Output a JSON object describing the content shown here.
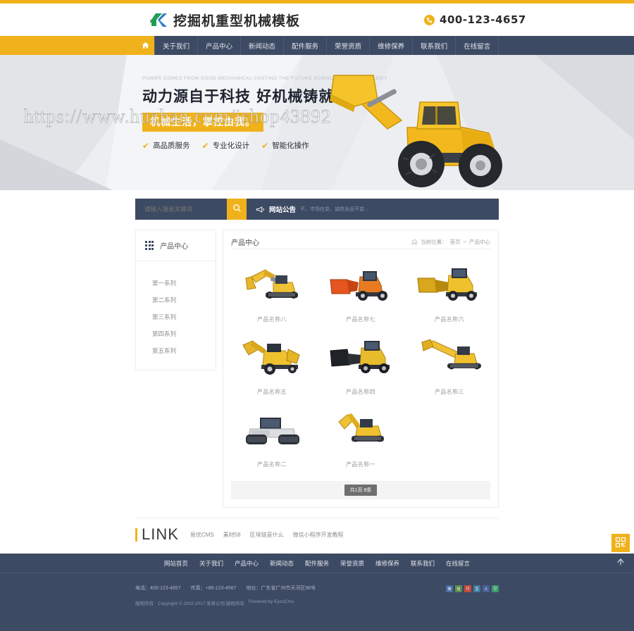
{
  "header": {
    "logo_text": "挖掘机重型机械模板",
    "logo_icon": "k-logo-icon",
    "phone_icon": "phone-icon",
    "phone": "400-123-4657"
  },
  "nav": {
    "home_icon": "home-icon",
    "items": [
      {
        "label": "关于我们"
      },
      {
        "label": "产品中心"
      },
      {
        "label": "新闻动态"
      },
      {
        "label": "配件服务"
      },
      {
        "label": "荣誉资质"
      },
      {
        "label": "维修保养"
      },
      {
        "label": "联系我们"
      },
      {
        "label": "在线留言"
      }
    ]
  },
  "banner": {
    "eng_line": "POWER COMES FROM GOOD MECHANICAL CASTING THE FUTURE SCIENCE AND TECHNOLOGY",
    "headline": "动力源自于科技  好机械铸就未来",
    "subline": "机械生活，掌控由我。",
    "features": [
      {
        "label": "高品质服务"
      },
      {
        "label": "专业化设计"
      },
      {
        "label": "智能化操作"
      }
    ],
    "watermark": "https://www.huzhan.com/ishop43892"
  },
  "search": {
    "placeholder": "请输入搜索关键词",
    "value": "",
    "search_icon": "search-icon",
    "horn_icon": "megaphone-icon",
    "notice_title": "网站公告",
    "notice_text": "不，市场在变，诚信永远不变..."
  },
  "sidebar": {
    "icon": "grid-icon",
    "title": "产品中心",
    "items": [
      {
        "label": "第一系列"
      },
      {
        "label": "第二系列"
      },
      {
        "label": "第三系列"
      },
      {
        "label": "第四系列"
      },
      {
        "label": "第五系列"
      }
    ]
  },
  "content": {
    "title": "产品中心",
    "home_icon": "home-small-icon",
    "breadcrumb_label": "当前位置：",
    "breadcrumb_home": "首页",
    "breadcrumb_sep": ">",
    "breadcrumb_current": "产品中心",
    "products": [
      {
        "name": "产品名称八",
        "image": "excavator-yellow"
      },
      {
        "name": "产品名称七",
        "image": "loader-orange"
      },
      {
        "name": "产品名称六",
        "image": "loader-yellow"
      },
      {
        "name": "产品名称五",
        "image": "backhoe-yellow"
      },
      {
        "name": "产品名称四",
        "image": "loader-black"
      },
      {
        "name": "产品名称三",
        "image": "excavator-long-arm"
      },
      {
        "name": "产品名称二",
        "image": "road-roller"
      },
      {
        "name": "产品名称一",
        "image": "excavator-small"
      }
    ],
    "pager_label": "共1页 8条"
  },
  "links": {
    "title": "LINK",
    "items": [
      {
        "label": "易优CMS"
      },
      {
        "label": "素材58"
      },
      {
        "label": "区块链是什么"
      },
      {
        "label": "微信小程序开发教程"
      }
    ]
  },
  "footer": {
    "nav": [
      {
        "label": "网站首页"
      },
      {
        "label": "关于我们"
      },
      {
        "label": "产品中心"
      },
      {
        "label": "新闻动态"
      },
      {
        "label": "配件服务"
      },
      {
        "label": "荣誉资质"
      },
      {
        "label": "维修保养"
      },
      {
        "label": "联系我们"
      },
      {
        "label": "在线留言"
      }
    ],
    "phone": "电话：400-123-4657",
    "fax": "传真：+86-123-4567",
    "address": "地址：广东省广州市天河区98号",
    "copyright_prefix": "版权所有",
    "copyright": "Copyright © 2002-2017 某某公司 版权所有",
    "powered_by": "Powered by EyouCms",
    "socials": [
      {
        "name": "weibo",
        "glyph": "微",
        "color": "#4a6fa5"
      },
      {
        "name": "wechat",
        "glyph": "信",
        "color": "#5a8f4a"
      },
      {
        "name": "qzone",
        "glyph": "Q",
        "color": "#c84a3a"
      },
      {
        "name": "douban",
        "glyph": "豆",
        "color": "#3f7a9b"
      },
      {
        "name": "renren",
        "glyph": "人",
        "color": "#4a5f9b"
      },
      {
        "name": "qq",
        "glyph": "Q",
        "color": "#3f9b6e"
      }
    ]
  },
  "float_widget": {
    "qr_icon": "qrcode-icon",
    "top_icon": "arrow-up-icon"
  },
  "colors": {
    "accent": "#f0b21b",
    "navy": "#3d4a63",
    "text": "#333333"
  }
}
